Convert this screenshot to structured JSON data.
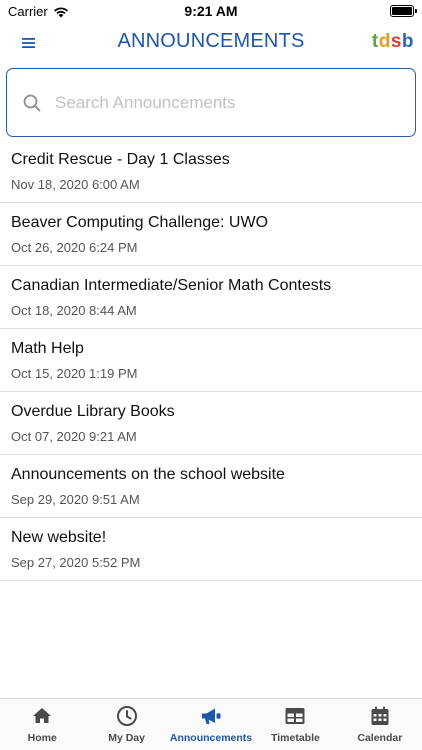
{
  "status_bar": {
    "carrier": "Carrier",
    "time": "9:21 AM"
  },
  "nav": {
    "title": "ANNOUNCEMENTS",
    "logo_letters": [
      "t",
      "d",
      "s",
      "b"
    ],
    "logo_colors": [
      "#56a745",
      "#e89a2b",
      "#d23f35",
      "#2a66b8"
    ],
    "accent_color": "#1f57a7"
  },
  "search": {
    "placeholder": "Search Announcements",
    "value": ""
  },
  "announcements": [
    {
      "title": "Credit Rescue - Day 1 Classes",
      "date": "Nov 18, 2020 6:00 AM"
    },
    {
      "title": "Beaver Computing Challenge: UWO",
      "date": "Oct 26, 2020 6:24 PM"
    },
    {
      "title": "Canadian Intermediate/Senior Math Contests",
      "date": "Oct 18, 2020 8:44 AM"
    },
    {
      "title": "Math Help",
      "date": "Oct 15, 2020 1:19 PM"
    },
    {
      "title": "Overdue Library Books",
      "date": "Oct 07, 2020 9:21 AM"
    },
    {
      "title": "Announcements on the school website",
      "date": "Sep 29, 2020 9:51 AM"
    },
    {
      "title": "New website!",
      "date": "Sep 27, 2020 5:52 PM"
    }
  ],
  "tabs": [
    {
      "label": "Home",
      "icon": "home-icon",
      "active": false
    },
    {
      "label": "My Day",
      "icon": "clock-icon",
      "active": false
    },
    {
      "label": "Announcements",
      "icon": "megaphone-icon",
      "active": true
    },
    {
      "label": "Timetable",
      "icon": "table-icon",
      "active": false
    },
    {
      "label": "Calendar",
      "icon": "calendar-icon",
      "active": false
    }
  ]
}
